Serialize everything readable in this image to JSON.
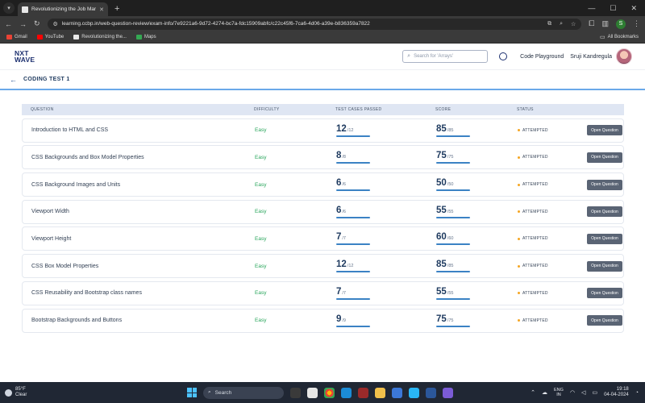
{
  "browser": {
    "tab_title": "Revolutionizing the Job Market",
    "url": "learning.ccbp.in/web-question-review/exam-info/7e9221a6-9d72-4274-bc7a-fdc15909abfc/c22c45f6-7ca6-4d06-a39e-b836359a7822",
    "profile_initial": "S",
    "bookmarks": [
      "Gmail",
      "YouTube",
      "Revolutionizing the...",
      "Maps"
    ],
    "all_bookmarks": "All Bookmarks"
  },
  "header": {
    "logo_line1": "NXT",
    "logo_line2": "WAVE",
    "search_placeholder": "Search for 'Arrays'",
    "code_playground": "Code Playground",
    "user_name": "Sruji Kandregula"
  },
  "subheader": {
    "title": "CODING TEST 1"
  },
  "table": {
    "headers": [
      "QUESTION",
      "DIFFICULTY",
      "TEST CASES PASSED",
      "SCORE",
      "STATUS"
    ],
    "button_label": "Open Question",
    "rows": [
      {
        "title": "Introduction to HTML and CSS",
        "difficulty": "Easy",
        "passed": "12",
        "passed_total": "/12",
        "score": "85",
        "score_total": "/85",
        "status": "ATTEMPTED"
      },
      {
        "title": "CSS Backgrounds and Box Model Properties",
        "difficulty": "Easy",
        "passed": "8",
        "passed_total": "/8",
        "score": "75",
        "score_total": "/75",
        "status": "ATTEMPTED"
      },
      {
        "title": "CSS Background Images and Units",
        "difficulty": "Easy",
        "passed": "6",
        "passed_total": "/6",
        "score": "50",
        "score_total": "/50",
        "status": "ATTEMPTED"
      },
      {
        "title": "Viewport Width",
        "difficulty": "Easy",
        "passed": "6",
        "passed_total": "/6",
        "score": "55",
        "score_total": "/55",
        "status": "ATTEMPTED"
      },
      {
        "title": "Viewport Height",
        "difficulty": "Easy",
        "passed": "7",
        "passed_total": "/7",
        "score": "60",
        "score_total": "/60",
        "status": "ATTEMPTED"
      },
      {
        "title": "CSS Box Model Properties",
        "difficulty": "Easy",
        "passed": "12",
        "passed_total": "/12",
        "score": "85",
        "score_total": "/85",
        "status": "ATTEMPTED"
      },
      {
        "title": "CSS Reusability and Bootstrap class names",
        "difficulty": "Easy",
        "passed": "7",
        "passed_total": "/7",
        "score": "55",
        "score_total": "/55",
        "status": "ATTEMPTED"
      },
      {
        "title": "Bootstrap Backgrounds and Buttons",
        "difficulty": "Easy",
        "passed": "9",
        "passed_total": "/9",
        "score": "75",
        "score_total": "/75",
        "status": "ATTEMPTED"
      }
    ]
  },
  "taskbar": {
    "temperature": "85°F",
    "weather": "Clear",
    "search": "Search",
    "lang1": "ENG",
    "lang2": "IN",
    "time": "19:18",
    "date": "04-04-2024"
  },
  "colors": {
    "accent": "#3b82c4",
    "easy": "#27a55a",
    "attempted_dot": "#f5a623",
    "button": "#5a6474"
  }
}
